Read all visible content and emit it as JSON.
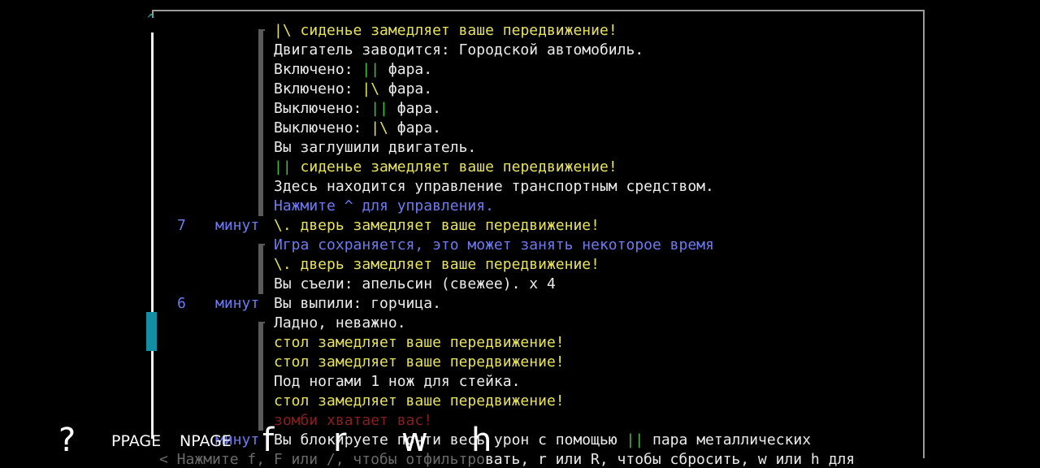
{
  "messages": [
    {
      "parts": [
        {
          "text": "|\\",
          "c": "y"
        },
        {
          "text": " сиденье замедляет ваше передвижение!",
          "c": "y"
        }
      ]
    },
    {
      "parts": [
        {
          "text": "Двигатель заводится: Городской автомобиль.",
          "c": "w"
        }
      ]
    },
    {
      "parts": [
        {
          "text": "Включено: ",
          "c": "w"
        },
        {
          "text": "||",
          "c": "g"
        },
        {
          "text": " фара.",
          "c": "w"
        }
      ]
    },
    {
      "parts": [
        {
          "text": "Включено: ",
          "c": "w"
        },
        {
          "text": "|\\",
          "c": "y"
        },
        {
          "text": " фара.",
          "c": "w"
        }
      ]
    },
    {
      "parts": [
        {
          "text": "Выключено: ",
          "c": "w"
        },
        {
          "text": "||",
          "c": "g"
        },
        {
          "text": " фара.",
          "c": "w"
        }
      ]
    },
    {
      "parts": [
        {
          "text": "Выключено: ",
          "c": "w"
        },
        {
          "text": "|\\",
          "c": "y"
        },
        {
          "text": " фара.",
          "c": "w"
        }
      ]
    },
    {
      "parts": [
        {
          "text": "Вы заглушили двигатель.",
          "c": "w"
        }
      ]
    },
    {
      "parts": [
        {
          "text": "||",
          "c": "g"
        },
        {
          "text": " сиденье замедляет ваше передвижение!",
          "c": "y"
        }
      ]
    },
    {
      "parts": [
        {
          "text": "Здесь находится управление транспортным средством.",
          "c": "w"
        }
      ]
    },
    {
      "parts": [
        {
          "text": "Нажмите ^ для управления.",
          "c": "b"
        }
      ]
    },
    {
      "parts": [
        {
          "text": "\\. дверь замедляет ваше передвижение!",
          "c": "y"
        }
      ]
    },
    {
      "parts": [
        {
          "text": "Игра сохраняется, это может занять некоторое время",
          "c": "b"
        }
      ]
    },
    {
      "parts": [
        {
          "text": "\\. дверь замедляет ваше передвижение!",
          "c": "y"
        }
      ]
    },
    {
      "parts": [
        {
          "text": "Вы съели: апельсин (свежее). x 4",
          "c": "w"
        }
      ]
    },
    {
      "parts": [
        {
          "text": "Вы выпили: горчица.",
          "c": "w"
        }
      ]
    },
    {
      "parts": [
        {
          "text": "Ладно, неважно.",
          "c": "w"
        }
      ]
    },
    {
      "parts": [
        {
          "text": "стол замедляет ваше передвижение!",
          "c": "y"
        }
      ]
    },
    {
      "parts": [
        {
          "text": "стол замедляет ваше передвижение!",
          "c": "y"
        }
      ]
    },
    {
      "parts": [
        {
          "text": "Под ногами 1 нож для стейка.",
          "c": "w"
        }
      ]
    },
    {
      "parts": [
        {
          "text": "стол замедляет ваше передвижение!",
          "c": "y"
        }
      ]
    },
    {
      "parts": [
        {
          "text": "зомби хватает вас!",
          "c": "r"
        }
      ]
    },
    {
      "parts": [
        {
          "text": "Вы блокируете почти весь урон с помощью ",
          "c": "w"
        },
        {
          "text": "||",
          "c": "g"
        },
        {
          "text": " пара металлических",
          "c": "w"
        }
      ]
    }
  ],
  "timestamps": [
    {
      "row": 10,
      "num": "7",
      "unit": "минут"
    },
    {
      "row": 14,
      "num": "6",
      "unit": "минут"
    },
    {
      "row": 21,
      "num": "",
      "unit": "минут"
    }
  ],
  "keys": {
    "help": "?",
    "pgup": "PPAGE",
    "pgdn": "NPAGE",
    "filter": "f",
    "reset": "r",
    "up": "w",
    "down": "h"
  },
  "hint": {
    "prefix": "< Нажмите f, F или /, чтобы отфильтро",
    "suffix": "вать, r или R, чтобы сбросить, w или h для"
  },
  "colors": {
    "yellow": "#e8e25a",
    "white": "#ececec",
    "blue": "#6e7bf0",
    "green": "#3fc13f",
    "red": "#8a1e1e",
    "scroll_thumb": "#118ea3"
  }
}
